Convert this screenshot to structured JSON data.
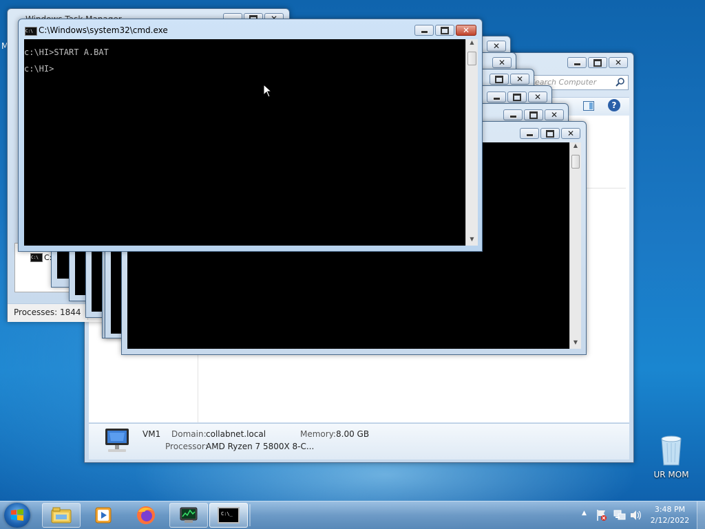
{
  "cmd": {
    "title": "C:\\Windows\\system32\\cmd.exe",
    "lines": [
      "c:\\HI>START A.BAT",
      "c:\\HI>"
    ]
  },
  "task_manager": {
    "title": "Windows Task Manager",
    "item_label": "C:",
    "status_processes": "Processes: 1844"
  },
  "explorer": {
    "search_placeholder": "Search Computer",
    "details": {
      "computer_name": "VM1",
      "domain_label": "Domain:",
      "domain_value": "collabnet.local",
      "memory_label": "Memory:",
      "memory_value": "8.00 GB",
      "processor_label": "Processor:",
      "processor_value": "AMD Ryzen 7 5800X 8-C..."
    }
  },
  "desktop": {
    "recycle_bin_label": "UR MOM",
    "left_edge_glyph": "M"
  },
  "taskbar": {
    "start_icon": "windows-orb-icon",
    "apps": [
      "explorer-icon",
      "media-player-icon",
      "firefox-icon",
      "task-manager-icon",
      "cmd-icon"
    ],
    "time": "3:48 PM",
    "date": "2/12/2022"
  },
  "colors": {
    "accent": "#1b78c4",
    "console_bg": "#000000",
    "console_text": "#c0c0c0",
    "close_red": "#c0432b"
  }
}
